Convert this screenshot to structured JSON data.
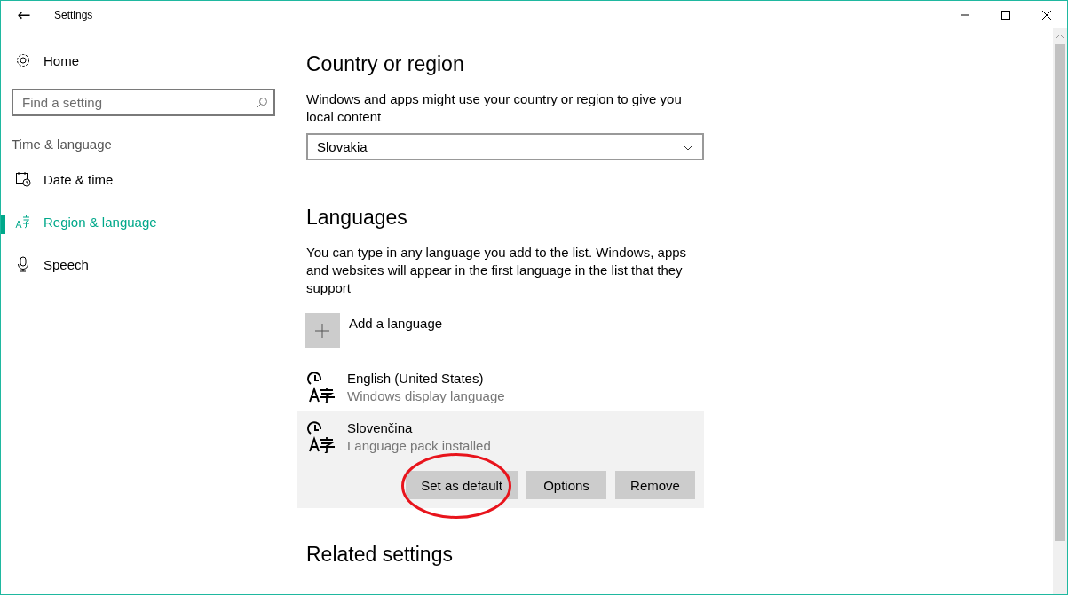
{
  "window": {
    "title": "Settings",
    "back_button": "←"
  },
  "sidebar": {
    "home": "Home",
    "search": {
      "placeholder": "Find a setting"
    },
    "category": "Time & language",
    "items": [
      {
        "label": "Date & time",
        "kind": "calendar",
        "selected": false
      },
      {
        "label": "Region & language",
        "kind": "language",
        "selected": true
      },
      {
        "label": "Speech",
        "kind": "microphone",
        "selected": false
      }
    ]
  },
  "country": {
    "heading": "Country or region",
    "description": "Windows and apps might use your country or region to give you local content",
    "value": "Slovakia"
  },
  "languages": {
    "heading": "Languages",
    "description": "You can type in any language you add to the list. Windows, apps and websites will appear in the first language in the list that they support",
    "add_label": "Add a language",
    "items": [
      {
        "name": "English (United States)",
        "status": "Windows display language",
        "selected": false
      },
      {
        "name": "Slovenčina",
        "status": "Language pack installed",
        "selected": true,
        "buttons": [
          {
            "label": "Set as default",
            "circled": true
          },
          {
            "label": "Options",
            "circled": false
          },
          {
            "label": "Remove",
            "circled": false
          }
        ]
      }
    ]
  },
  "related": {
    "heading": "Related settings"
  }
}
